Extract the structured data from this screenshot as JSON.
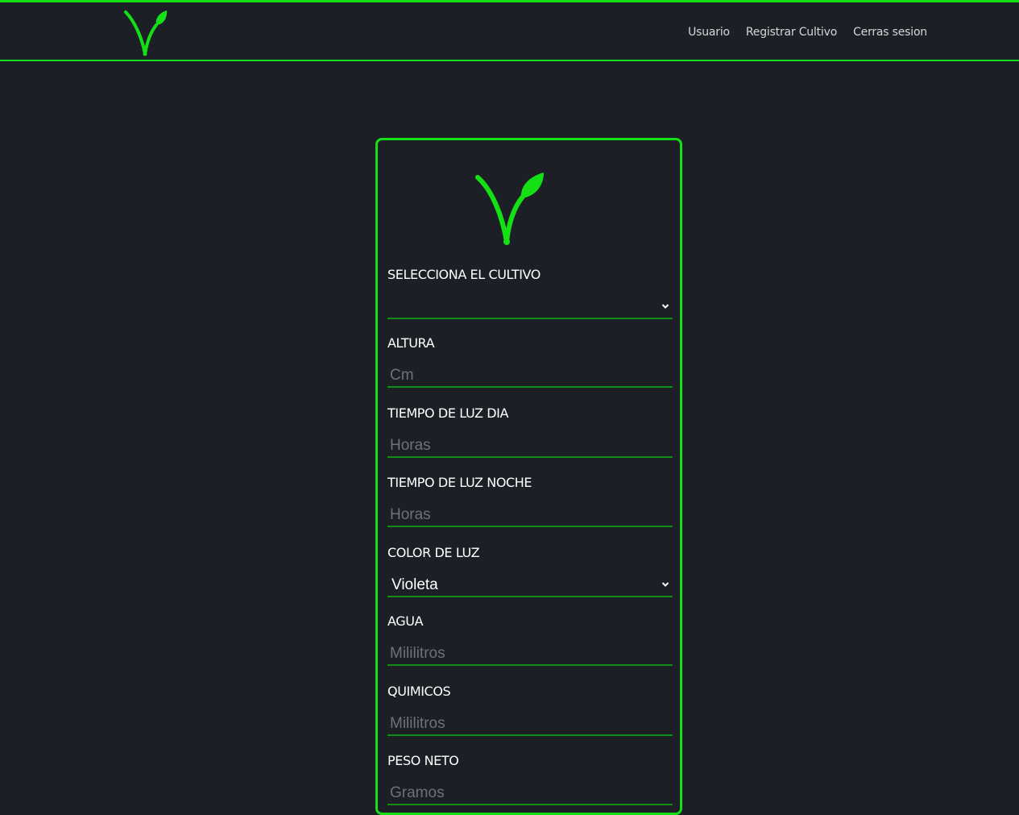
{
  "nav": {
    "logo_icon": "sprout-v-icon",
    "links": [
      "Usuario",
      "Registrar Cultivo",
      "Cerras sesion"
    ]
  },
  "colors": {
    "accent": "#15e015",
    "background": "#1c2026",
    "underline": "#118e11"
  },
  "form": {
    "logo_icon": "sprout-v-icon",
    "cultivo": {
      "label": "SELECCIONA EL CULTIVO",
      "value": ""
    },
    "altura": {
      "label": "ALTURA",
      "placeholder": "Cm"
    },
    "luz_dia": {
      "label": "TIEMPO DE LUZ DIA",
      "placeholder": "Horas"
    },
    "luz_noche": {
      "label": "TIEMPO DE LUZ NOCHE",
      "placeholder": "Horas"
    },
    "color_luz": {
      "label": "COLOR DE LUZ",
      "value": "Violeta"
    },
    "agua": {
      "label": "AGUA",
      "placeholder": "Mililitros"
    },
    "quimicos": {
      "label": "QUIMICOS",
      "placeholder": "Mililitros"
    },
    "peso_neto": {
      "label": "PESO NETO",
      "placeholder": "Gramos"
    }
  }
}
